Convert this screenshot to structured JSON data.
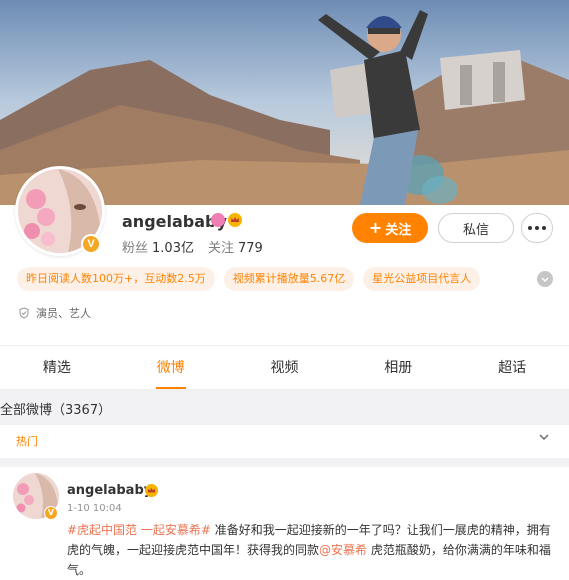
{
  "profile": {
    "name": "angelababy",
    "verified_badge": "V",
    "fans_label": "粉丝",
    "fans_count": "1.03亿",
    "following_label": "关注",
    "following_count": "779",
    "follow_button": "关注",
    "message_button": "私信",
    "tags": [
      "昨日阅读人数100万+，互动数2.5万",
      "视频累计播放量5.67亿",
      "星光公益项目代言人"
    ],
    "profession": "演员、艺人"
  },
  "tabs": [
    {
      "label": "精选",
      "active": false
    },
    {
      "label": "微博",
      "active": true
    },
    {
      "label": "视频",
      "active": false
    },
    {
      "label": "相册",
      "active": false
    },
    {
      "label": "超话",
      "active": false
    }
  ],
  "feed": {
    "all_posts": "全部微博（3367）",
    "filter": "热门"
  },
  "post": {
    "author": "angelababy",
    "time": "1-10 10:04",
    "hashtag": "#虎起中国范 一起安慕希#",
    "text_part1": " 准备好和我一起迎接新的一年了吗？让我们一展虎的精神，拥有虎的气魄，一起迎接虎范中国年！获得我的同款",
    "mention": "@安慕希",
    "text_part2": " 虎范瓶酸奶，给你满满的年味和福气。"
  },
  "colors": {
    "accent": "#ff8200",
    "link": "#eb7350",
    "tag_bg": "#fdf1e7",
    "gold_badge": "#f5a623"
  },
  "icons": {
    "follow": "plus-icon",
    "more": "more-dots-icon",
    "expand": "chevron-down-icon",
    "profession": "shield-icon",
    "verified": "verified-v-icon",
    "member": "crown-icon",
    "level": "pink-badge-icon"
  }
}
